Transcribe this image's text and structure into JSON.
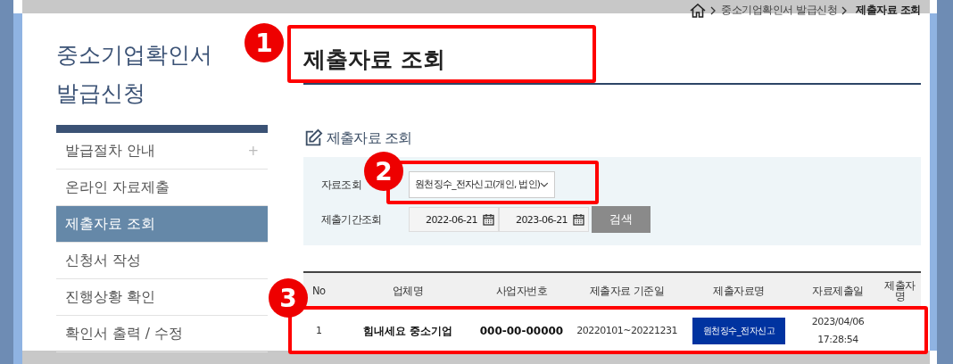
{
  "breadcrumb": [
    "중소기업확인서 발급신청",
    "제출자료 조회"
  ],
  "sidebar": {
    "title": "중소기업확인서\n발급신청",
    "items": [
      {
        "label": "발급절차 안내",
        "selected": false,
        "expand_mark": "+"
      },
      {
        "label": "온라인 자료제출",
        "selected": false
      },
      {
        "label": "제출자료 조회",
        "selected": true
      },
      {
        "label": "신청서 작성",
        "selected": false
      },
      {
        "label": "진행상황 확인",
        "selected": false
      },
      {
        "label": "확인서 출력 / 수정",
        "selected": false
      }
    ]
  },
  "page_title": "제출자료 조회",
  "section_title": "제출자료 조회",
  "search": {
    "type_label": "자료조회",
    "type_value": "원천징수_전자신고(개인, 법인)",
    "period_label": "제출기간조회",
    "date_from": "2022-06-21",
    "date_to": "2023-06-21",
    "button": "검색"
  },
  "table": {
    "columns": [
      "No",
      "업체명",
      "사업자번호",
      "제출자료 기준일",
      "제출자료명",
      "자료제출일",
      "제출자\n명"
    ],
    "rows": [
      {
        "no": "1",
        "company": "힘내세요 중소기업",
        "biz_no": "000-00-00000",
        "period": "20220101~20221231",
        "doc": "원천징수_전자신고",
        "submitted": "2023/04/06\n17:28:54"
      }
    ]
  },
  "annotations": [
    {
      "number": "1"
    },
    {
      "number": "2"
    },
    {
      "number": "3"
    }
  ]
}
